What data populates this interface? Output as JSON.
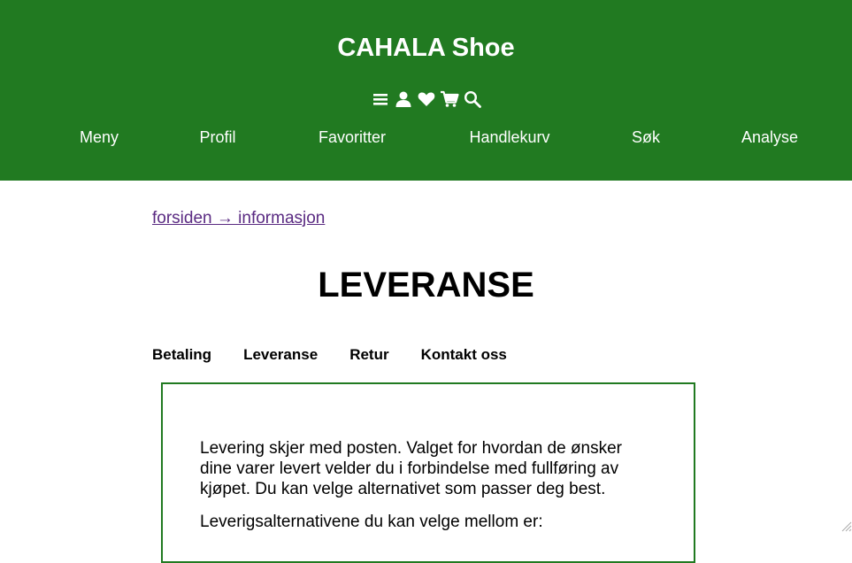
{
  "header": {
    "title": "CAHALA Shoe",
    "background_color": "#217a21",
    "icons": [
      "menu-icon",
      "user-icon",
      "heart-icon",
      "cart-icon",
      "search-icon"
    ]
  },
  "nav": {
    "items": [
      {
        "label": "Meny"
      },
      {
        "label": "Profil"
      },
      {
        "label": "Favoritter"
      },
      {
        "label": "Handlekurv"
      },
      {
        "label": "Søk"
      },
      {
        "label": "Analyse"
      }
    ]
  },
  "breadcrumb": {
    "text": "forsiden → informasjon"
  },
  "page": {
    "title": "LEVERANSE"
  },
  "tabs": [
    {
      "label": "Betaling"
    },
    {
      "label": "Leveranse"
    },
    {
      "label": "Retur"
    },
    {
      "label": "Kontakt oss"
    }
  ],
  "content": {
    "paragraph_1": "Levering skjer med posten. Valget for hvordan de ønsker dine varer levert velder du i forbindelse med fullføring av kjøpet. Du kan velge alternativet som passer deg best.",
    "paragraph_2": "Leverigsalternativene du kan velge mellom er:"
  }
}
